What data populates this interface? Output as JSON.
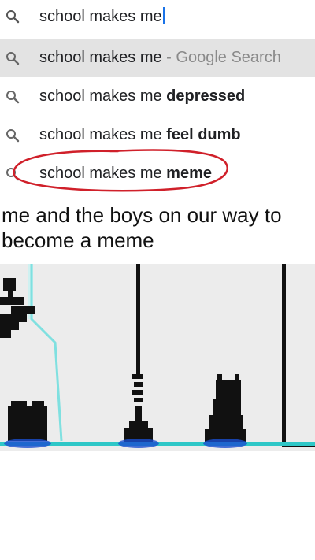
{
  "search": {
    "query": "school makes me",
    "suggestions": [
      {
        "base": "school makes me",
        "bold": "",
        "suffix": " - Google Search",
        "highlighted": true
      },
      {
        "base": "school makes me ",
        "bold": "depressed",
        "suffix": "",
        "highlighted": false
      },
      {
        "base": "school makes me ",
        "bold": "feel dumb",
        "suffix": "",
        "highlighted": false
      },
      {
        "base": "school makes me ",
        "bold": "meme",
        "suffix": "",
        "highlighted": false,
        "circled": true
      }
    ]
  },
  "caption": "me and the boys on our way to become a meme",
  "colors": {
    "highlight": "#e3e3e3",
    "circle": "#d0202a",
    "ground": "#2ec7c7",
    "cursor": "#1a73e8"
  }
}
